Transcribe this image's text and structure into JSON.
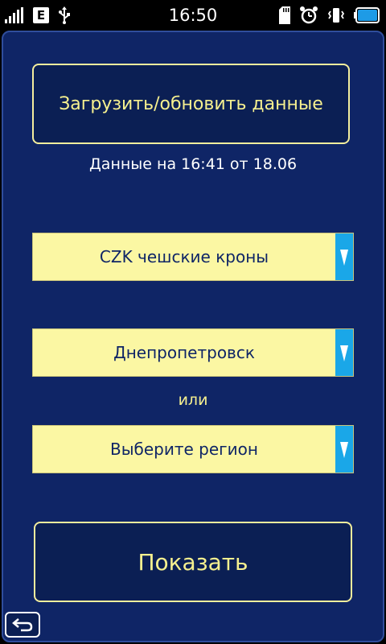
{
  "status_bar": {
    "time": "16:50",
    "network_badge": "E",
    "icons_left": [
      "signal-icon",
      "edge-network-icon",
      "usb-icon"
    ],
    "icons_right": [
      "sd-card-icon",
      "alarm-icon",
      "vibrate-icon",
      "battery-icon"
    ]
  },
  "main": {
    "load_button_label": "Загрузить/обновить данные",
    "data_info": "Данные на 16:41 от 18.06",
    "currency_select": {
      "value": "CZK чешские кроны"
    },
    "city_select": {
      "value": "Днепропетровск"
    },
    "or_label": "или",
    "region_select": {
      "value": "Выберите регион"
    },
    "show_button_label": "Показать"
  },
  "footer": {
    "back_icon": "back-arrow-icon"
  },
  "colors": {
    "background": "#0f2566",
    "button_text": "#f6f08f",
    "dropdown_bg": "#fbf7a3",
    "dropdown_arrow": "#1aa7e8"
  }
}
